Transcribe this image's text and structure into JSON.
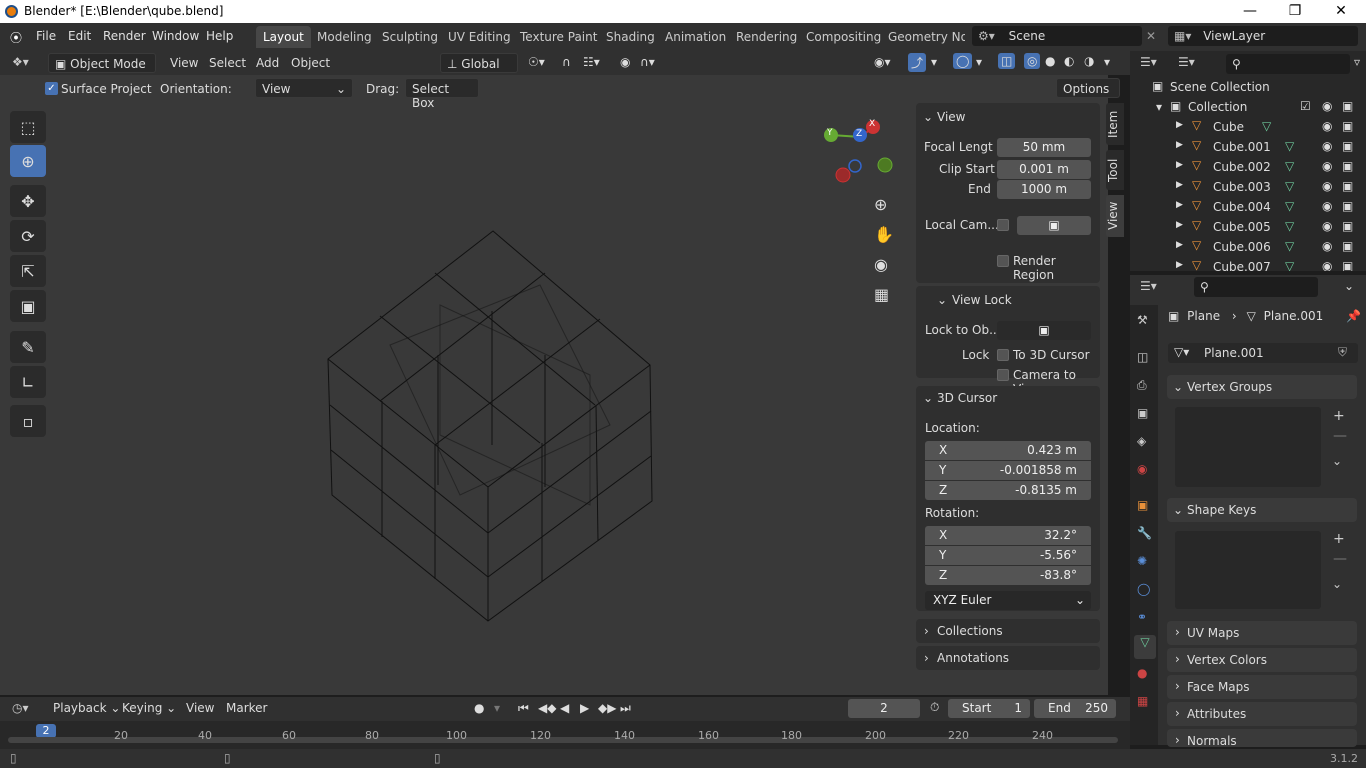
{
  "titlebar": {
    "title": "Blender* [E:\\Blender\\qube.blend]"
  },
  "menus": [
    "File",
    "Edit",
    "Render",
    "Window",
    "Help"
  ],
  "workspaces": [
    "Layout",
    "Modeling",
    "Sculpting",
    "UV Editing",
    "Texture Paint",
    "Shading",
    "Animation",
    "Rendering",
    "Compositing",
    "Geometry Nod"
  ],
  "scene": {
    "name": "Scene",
    "view_layer": "ViewLayer"
  },
  "viewport_header": {
    "mode": "Object Mode",
    "menus": [
      "View",
      "Select",
      "Add",
      "Object"
    ],
    "orientation_global": "Global"
  },
  "tool_header": {
    "surface_project": "Surface Project",
    "orientation_label": "Orientation:",
    "orientation_value": "View",
    "drag_label": "Drag:",
    "drag_value": "Select Box",
    "options": "Options"
  },
  "npanel": {
    "tabs": [
      "Item",
      "Tool",
      "View"
    ],
    "view": {
      "header": "View",
      "focal_label": "Focal Lengt",
      "focal_value": "50 mm",
      "clip_start_label": "Clip Start",
      "clip_start_value": "0.001 m",
      "end_label": "End",
      "end_value": "1000 m",
      "local_cam_label": "Local Cam...",
      "render_region": "Render Region"
    },
    "view_lock": {
      "header": "View Lock",
      "lock_to_label": "Lock to Ob...",
      "lock_label": "Lock",
      "to_3d_cursor": "To 3D Cursor",
      "camera_to_view": "Camera to Vi..."
    },
    "cursor": {
      "header": "3D Cursor",
      "location_label": "Location:",
      "loc": [
        {
          "axis": "X",
          "value": "0.423 m"
        },
        {
          "axis": "Y",
          "value": "-0.001858 m"
        },
        {
          "axis": "Z",
          "value": "-0.8135 m"
        }
      ],
      "rotation_label": "Rotation:",
      "rot": [
        {
          "axis": "X",
          "value": "32.2°"
        },
        {
          "axis": "Y",
          "value": "-5.56°"
        },
        {
          "axis": "Z",
          "value": "-83.8°"
        }
      ],
      "euler": "XYZ Euler"
    },
    "collections": "Collections",
    "annotations": "Annotations"
  },
  "gizmo": {
    "x": "X",
    "y": "Y",
    "z": "Z"
  },
  "outliner": {
    "scene_collection": "Scene Collection",
    "collection": "Collection",
    "items": [
      "Cube",
      "Cube.001",
      "Cube.002",
      "Cube.003",
      "Cube.004",
      "Cube.005",
      "Cube.006",
      "Cube.007"
    ]
  },
  "properties": {
    "breadcrumb_object": "Plane",
    "breadcrumb_data": "Plane.001",
    "data_name": "Plane.001",
    "sections": [
      "Vertex Groups",
      "Shape Keys",
      "UV Maps",
      "Vertex Colors",
      "Face Maps",
      "Attributes",
      "Normals"
    ]
  },
  "timeline": {
    "menus": [
      "Playback",
      "Keying",
      "View",
      "Marker"
    ],
    "current_frame": "2",
    "start_label": "Start",
    "start_value": "1",
    "end_label": "End",
    "end_value": "250",
    "ticks": [
      "20",
      "40",
      "60",
      "80",
      "100",
      "120",
      "140",
      "160",
      "180",
      "200",
      "220",
      "240"
    ],
    "playhead": "2"
  },
  "status": {
    "version": "3.1.2"
  }
}
